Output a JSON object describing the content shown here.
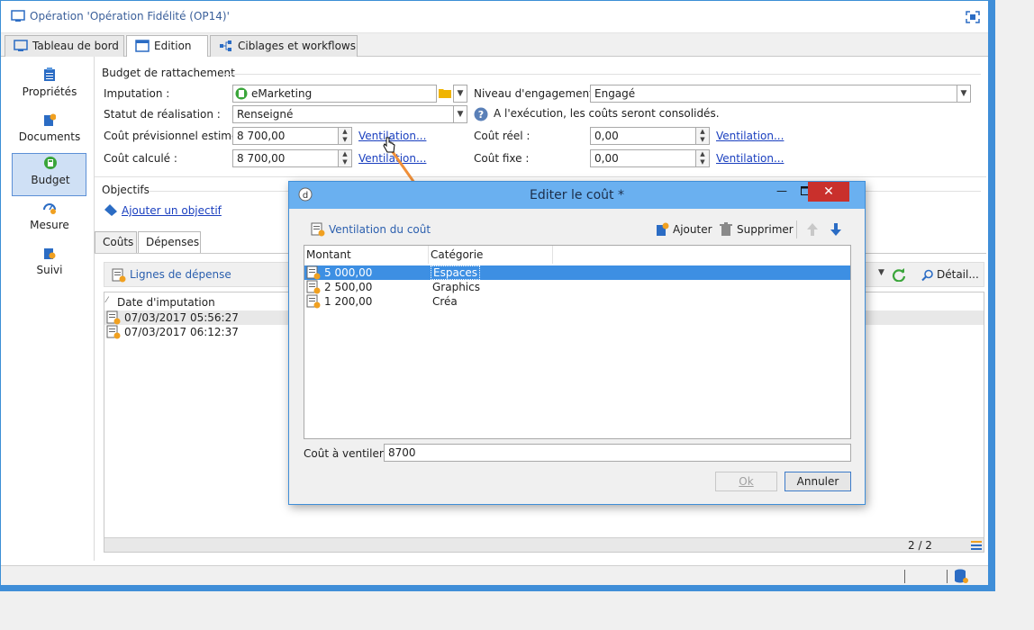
{
  "window": {
    "title": "Opération 'Opération Fidélité (OP14)'"
  },
  "top_tabs": [
    {
      "label": "Tableau de bord"
    },
    {
      "label": "Edition"
    },
    {
      "label": "Ciblages et workflows"
    }
  ],
  "nav": [
    {
      "label": "Propriétés"
    },
    {
      "label": "Documents"
    },
    {
      "label": "Budget"
    },
    {
      "label": "Mesure"
    },
    {
      "label": "Suivi"
    }
  ],
  "budget": {
    "section_title": "Budget de rattachement",
    "imputation_label": "Imputation :",
    "imputation_value": "eMarketing",
    "engagement_label": "Niveau d'engagement :",
    "engagement_value": "Engagé",
    "statut_label": "Statut de réalisation :",
    "statut_value": "Renseigné",
    "info_text": "A l'exécution, les coûts seront consolidés.",
    "cout_prev_label": "Coût prévisionnel estimé :",
    "cout_prev_value": "8 700,00",
    "cout_calc_label": "Coût calculé :",
    "cout_calc_value": "8 700,00",
    "cout_reel_label": "Coût réel :",
    "cout_reel_value": "0,00",
    "cout_fixe_label": "Coût fixe :",
    "cout_fixe_value": "0,00",
    "ventilation_link": "Ventilation..."
  },
  "objectifs": {
    "section_title": "Objectifs",
    "add_link": "Ajouter un objectif"
  },
  "sub_tabs": [
    {
      "label": "Coûts"
    },
    {
      "label": "Dépenses"
    }
  ],
  "depenses": {
    "toolbar_label": "Lignes de dépense",
    "detail_label": "Détail...",
    "column": "Date d'imputation",
    "rows": [
      "07/03/2017 05:56:27",
      "07/03/2017 06:12:37"
    ],
    "pager": "2 / 2"
  },
  "dialog": {
    "title": "Editer le coût *",
    "toolbar_label": "Ventilation du coût",
    "add_label": "Ajouter",
    "delete_label": "Supprimer",
    "columns": [
      "Montant",
      "Catégorie"
    ],
    "rows": [
      {
        "montant": "5 000,00",
        "categorie": "Espaces"
      },
      {
        "montant": "2 500,00",
        "categorie": "Graphics"
      },
      {
        "montant": "1 200,00",
        "categorie": "Créa"
      }
    ],
    "cout_label": "Coût à ventiler :",
    "cout_value": "8700",
    "ok_label": "Ok",
    "cancel_label": "Annuler"
  },
  "colors": {
    "accent": "#3f8ed8",
    "selection": "#3d8fe3",
    "link": "#1a3fbf",
    "close": "#c9302c"
  }
}
